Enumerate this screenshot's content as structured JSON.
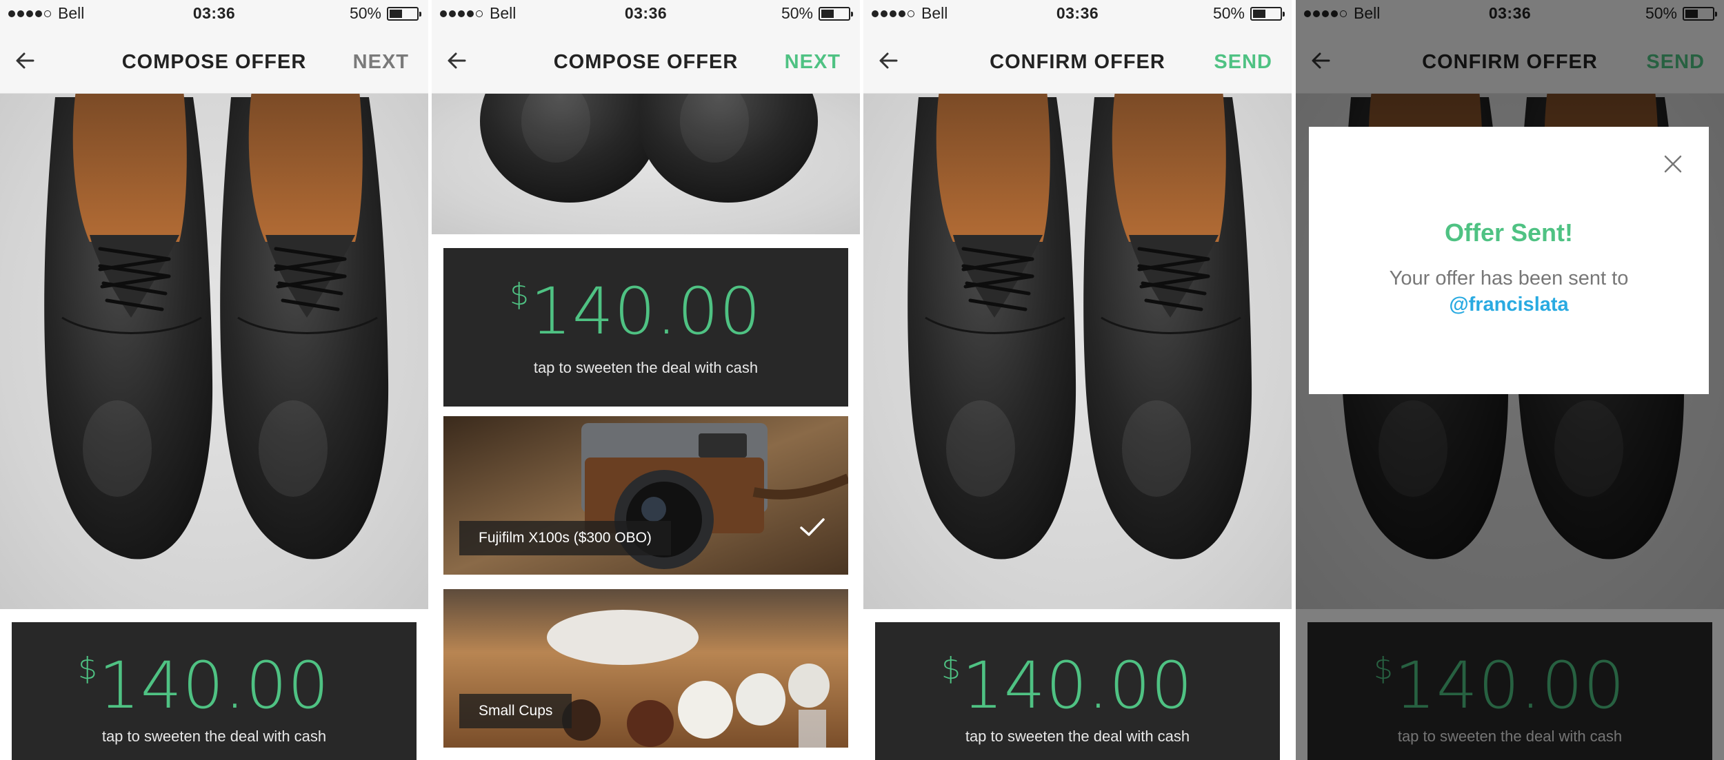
{
  "status_bar": {
    "carrier": "Bell",
    "time": "03:36",
    "battery": "50%"
  },
  "screens": [
    {
      "nav": {
        "title": "COMPOSE OFFER",
        "action": "NEXT"
      }
    },
    {
      "nav": {
        "title": "COMPOSE OFFER",
        "action": "NEXT"
      }
    },
    {
      "nav": {
        "title": "CONFIRM OFFER",
        "action": "SEND"
      }
    },
    {
      "nav": {
        "title": "CONFIRM OFFER",
        "action": "SEND"
      }
    }
  ],
  "offer": {
    "currency": "$",
    "amount": "140.00",
    "hint": "tap to sweeten the deal with cash"
  },
  "items": [
    {
      "label": "Fujifilm X100s ($300 OBO)",
      "selected": true
    },
    {
      "label": "Small Cups",
      "selected": false
    }
  ],
  "modal": {
    "title": "Offer Sent!",
    "message": "Your offer has been sent to",
    "handle": "@francislata"
  },
  "colors": {
    "accent_green": "#4fc283",
    "link_blue": "#29aae1",
    "card_dark": "#282828"
  }
}
